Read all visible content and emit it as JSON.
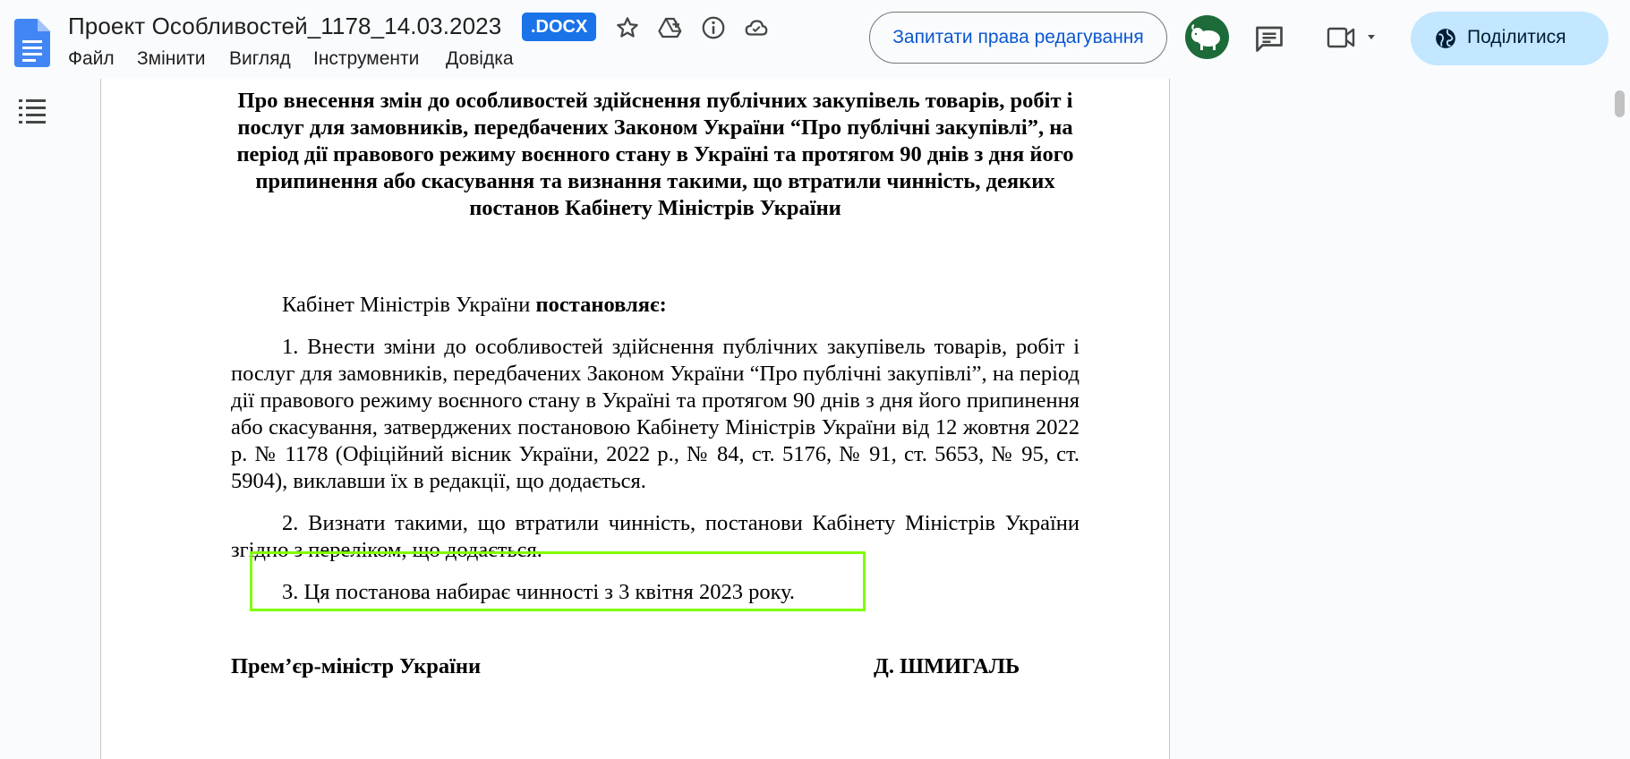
{
  "app": {
    "title": "Проект Особливостей_1178_14.03.2023",
    "format_badge": ".DOCX",
    "brand_color": "#1a73e8",
    "title_icons": [
      "star-icon",
      "move-to-drive-icon",
      "info-icon",
      "cloud-status-icon"
    ]
  },
  "menu": {
    "items": [
      "Файл",
      "Змінити",
      "Вигляд",
      "Інструменти",
      "Довідка"
    ]
  },
  "toolbar": {
    "request_edit_label": "Запитати права редагування",
    "share_label": "Поділитися",
    "share_color": "#c2e7ff",
    "avatar_icon": "bison-icon",
    "comments_icon": "comments-icon",
    "meet_icon": "video-camera-icon"
  },
  "sidebar": {
    "outline_icon": "document-outline-icon"
  },
  "document": {
    "heading": "Про внесення змін до особливостей здійснення публічних закупівель товарів, робіт і послуг для замовників, передбачених Законом України “Про публічні закупівлі”, на період дії правового режиму воєнного стану в Україні та протягом 90 днів з дня його припинення або скасування та визнання такими, що втратили чинність, деяких постанов Кабінету Міністрів України",
    "intro_plain": "Кабінет Міністрів України ",
    "intro_bold": "постановляє:",
    "paragraph_1": "1. Внести зміни до особливостей здійснення публічних закупівель товарів, робіт і послуг для замовників, передбачених Законом України “Про публічні закупівлі”, на період дії правового режиму воєнного стану в Україні та протягом 90 днів з дня його припинення або скасування, затверджених постановою Кабінету Міністрів України від 12 жовтня 2022 р. № 1178 (Офіційний вісник України, 2022 р., № 84, ст. 5176, № 91, ст. 5653, № 95, ст. 5904), виклавши їх в редакції, що додається.",
    "paragraph_2": "2. Визнати такими, що втратили чинність, постанови Кабінету Міністрів України згідно з переліком, що додається.",
    "paragraph_3": "3. Ця постанова набирає чинності з 3 квітня 2023 року.",
    "signature_title": "Прем’єр-міністр України",
    "signature_name": "Д. ШМИГАЛЬ",
    "highlight_color": "#7fff00"
  }
}
